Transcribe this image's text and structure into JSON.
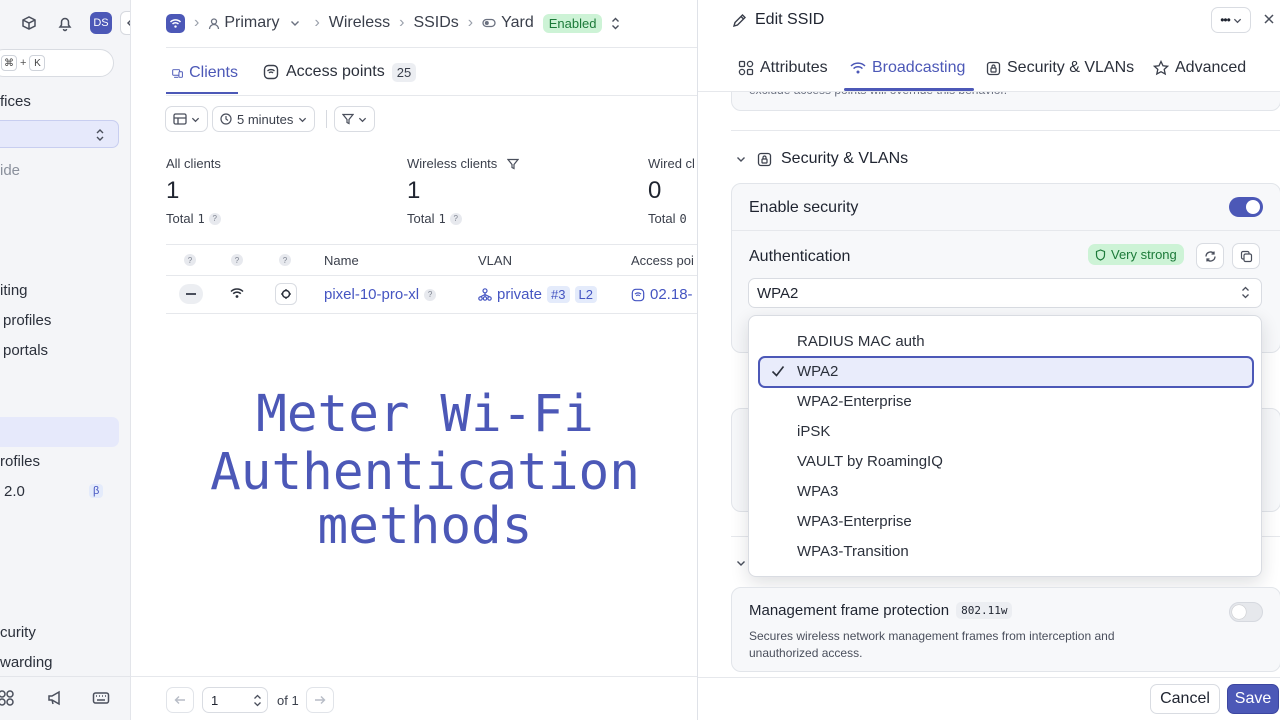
{
  "sidebar": {
    "user_initials": "DS",
    "shortcut": {
      "mod": "⌘",
      "plus": "+",
      "key": "K"
    },
    "items": [
      {
        "label": "fices"
      },
      {
        "label": "ide"
      },
      {
        "label": "iting"
      },
      {
        "label": "profiles"
      },
      {
        "label": "portals"
      },
      {
        "label": "rofiles"
      },
      {
        "label": "2.0",
        "badge": "β"
      },
      {
        "label": "curity"
      },
      {
        "label": "warding"
      }
    ]
  },
  "breadcrumb": {
    "primary": "Primary",
    "wireless": "Wireless",
    "ssids": "SSIDs",
    "yard": "Yard",
    "status": "Enabled"
  },
  "main_tabs": {
    "clients": "Clients",
    "access_points": "Access points",
    "access_points_count": "25"
  },
  "filters": {
    "time_range": "5 minutes"
  },
  "stats": [
    {
      "label": "All clients",
      "value": "1",
      "total_label": "Total",
      "total": "1"
    },
    {
      "label": "Wireless clients",
      "value": "1",
      "total_label": "Total",
      "total": "1"
    },
    {
      "label": "Wired cl",
      "value": "0",
      "total_label": "Total",
      "total": "0"
    }
  ],
  "table": {
    "columns": {
      "q1": "?",
      "q2": "?",
      "q3": "?",
      "name": "Name",
      "vlan": "VLAN",
      "access_point": "Access poi"
    },
    "rows": [
      {
        "name": "pixel-10-pro-xl",
        "vlan": "private",
        "vlan_id": "#3",
        "layer": "L2",
        "access_point": "02.18-"
      }
    ]
  },
  "pagination": {
    "page": "1",
    "of": "of 1"
  },
  "overlay": {
    "line1": "Meter Wi-Fi",
    "line2": "Authentication",
    "line3": "methods"
  },
  "panel": {
    "title": "Edit SSID",
    "tabs": {
      "attributes": "Attributes",
      "broadcasting": "Broadcasting",
      "security": "Security & VLANs",
      "advanced": "Advanced"
    },
    "clipped_text": "exclude access points will override this behavior.",
    "section_title": "Security & VLANs",
    "enable_security": "Enable security",
    "authentication_label": "Authentication",
    "strength_badge": "Very strong",
    "auth_value": "WPA2",
    "options": [
      "RADIUS MAC auth",
      "WPA2",
      "WPA2-Enterprise",
      "iPSK",
      "VAULT by RoamingIQ",
      "WPA3",
      "WPA3-Enterprise",
      "WPA3-Transition"
    ],
    "selected_option": "WPA2",
    "mfp_label": "Management frame protection",
    "mfp_tag": "802.11w",
    "mfp_desc_1": "Secures wireless network management frames from interception and",
    "mfp_desc_2": "unauthorized access.",
    "cancel": "Cancel",
    "save": "Save"
  },
  "colors": {
    "accent": "#4c58b7",
    "enabled_bg": "#cdf3d6",
    "enabled_text": "#1c7a39"
  }
}
